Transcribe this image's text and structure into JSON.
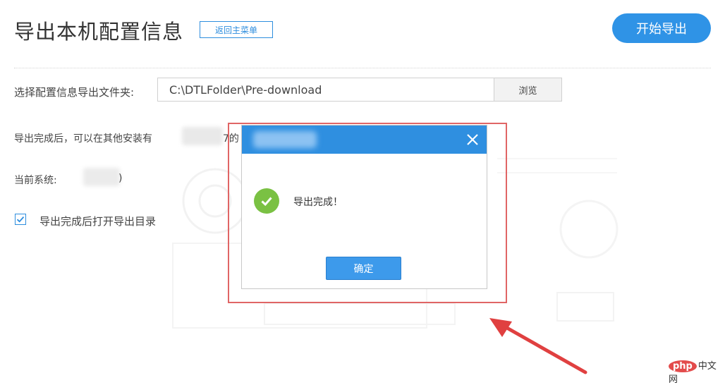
{
  "header": {
    "title": "导出本机配置信息",
    "back_label": "返回主菜单",
    "start_label": "开始导出"
  },
  "folder": {
    "label": "选择配置信息导出文件夹:",
    "path": "C:\\DTLFolder\\Pre-download",
    "browse_label": "浏览"
  },
  "info": {
    "text": "导出完成后，可以在其他安装有",
    "tail": "7的"
  },
  "system": {
    "label": "当前系统:",
    "suffix": ")"
  },
  "open_dir": {
    "checked": true,
    "label": "导出完成后打开导出目录"
  },
  "dialog": {
    "close_icon": "close-icon",
    "success_icon": "check-circle-icon",
    "message": "导出完成！",
    "confirm_label": "确定"
  },
  "watermark": {
    "php": "php",
    "cn": "中文网"
  },
  "colors": {
    "accent": "#2f93e6",
    "success": "#7ac143",
    "annotation": "#e06565"
  }
}
